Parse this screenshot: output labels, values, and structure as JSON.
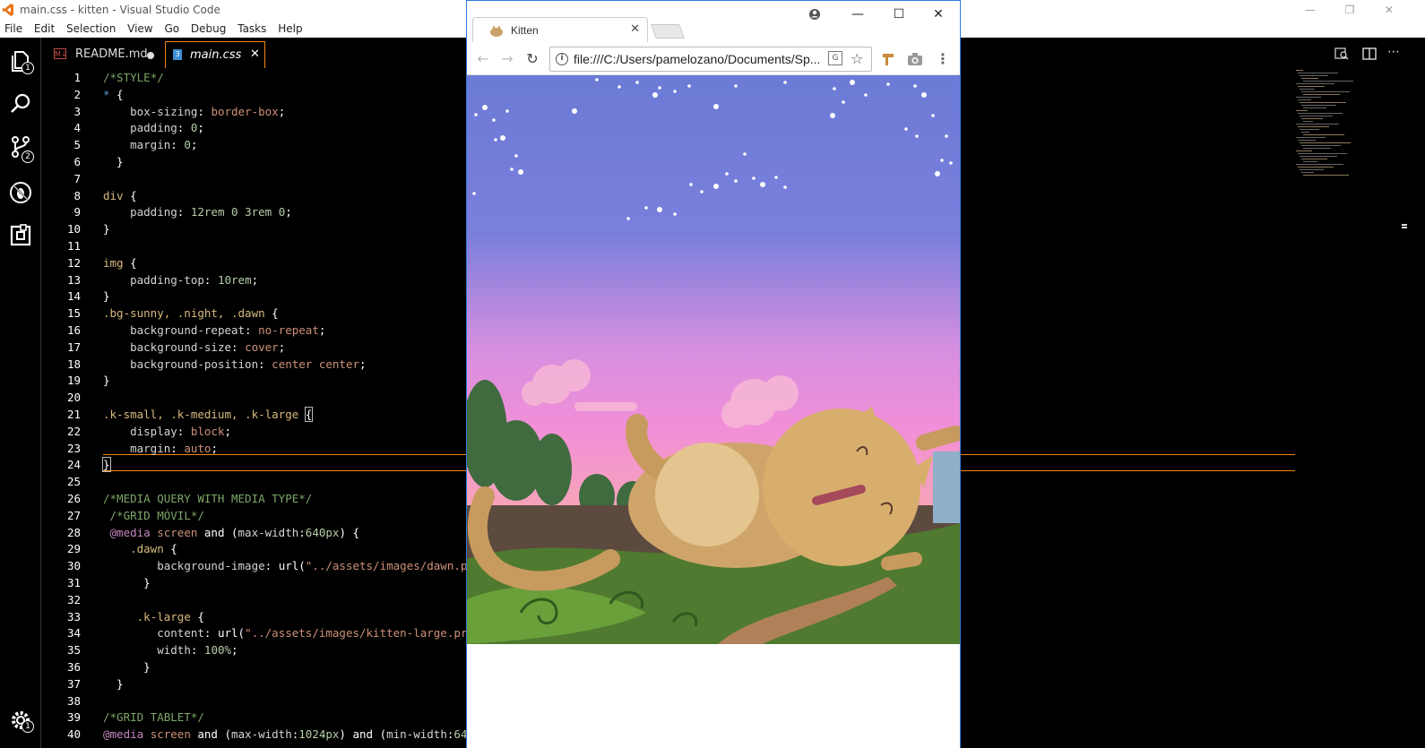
{
  "vscode": {
    "window_title": "main.css - kitten - Visual Studio Code",
    "menu": [
      "File",
      "Edit",
      "Selection",
      "View",
      "Go",
      "Debug",
      "Tasks",
      "Help"
    ],
    "tabs": [
      {
        "label": "README.md",
        "icon": "markdown-icon",
        "modified": true
      },
      {
        "label": "main.css",
        "icon": "css-icon",
        "active": true
      }
    ],
    "badges": {
      "explorer": "1",
      "scm": "2",
      "settings": "1"
    },
    "code": [
      {
        "n": "1",
        "html": "<span class='c-com'>/*STYLE*/</span>"
      },
      {
        "n": "2",
        "html": "<span class='c-kw'>*</span> {"
      },
      {
        "n": "3",
        "html": "    <span class='c-prop'>box-sizing</span>: <span class='c-val'>border-box</span>;"
      },
      {
        "n": "4",
        "html": "    <span class='c-prop'>padding</span>: <span class='c-num'>0</span>;"
      },
      {
        "n": "5",
        "html": "    <span class='c-prop'>margin</span>: <span class='c-num'>0</span>;"
      },
      {
        "n": "6",
        "html": "  }"
      },
      {
        "n": "7",
        "html": ""
      },
      {
        "n": "8",
        "html": "<span class='c-sel'>div</span> {"
      },
      {
        "n": "9",
        "html": "    <span class='c-prop'>padding</span>: <span class='c-num'>12rem</span> <span class='c-num'>0</span> <span class='c-num'>3rem</span> <span class='c-num'>0</span>;"
      },
      {
        "n": "10",
        "html": "}"
      },
      {
        "n": "11",
        "html": ""
      },
      {
        "n": "12",
        "html": "<span class='c-sel'>img</span> {"
      },
      {
        "n": "13",
        "html": "    <span class='c-prop'>padding-top</span>: <span class='c-num'>10rem</span>;"
      },
      {
        "n": "14",
        "html": "}"
      },
      {
        "n": "15",
        "html": "<span class='c-sel'>.bg-sunny, .night, .dawn</span> {"
      },
      {
        "n": "16",
        "html": "    <span class='c-prop'>background-repeat</span>: <span class='c-val'>no-repeat</span>;"
      },
      {
        "n": "17",
        "html": "    <span class='c-prop'>background-size</span>: <span class='c-val'>cover</span>;"
      },
      {
        "n": "18",
        "html": "    <span class='c-prop'>background-position</span>: <span class='c-val'>center center</span>;"
      },
      {
        "n": "19",
        "html": "}"
      },
      {
        "n": "20",
        "html": ""
      },
      {
        "n": "21",
        "html": "<span class='c-sel'>.k-small, .k-medium, .k-large</span> <span style='outline:1px solid #bbb'>{</span>"
      },
      {
        "n": "22",
        "html": "    <span class='c-prop'>display</span>: <span class='c-val'>block</span>;"
      },
      {
        "n": "23",
        "html": "    <span class='c-prop'>margin</span>: <span class='c-val'>auto</span>;"
      },
      {
        "n": "24",
        "html": "<span style='outline:1px solid #bbb'>}</span>"
      },
      {
        "n": "25",
        "html": ""
      },
      {
        "n": "26",
        "html": "<span class='c-com'>/*MEDIA QUERY WITH MEDIA TYPE*/</span>"
      },
      {
        "n": "27",
        "html": " <span class='c-com'>/*GRID MÓVIL*/</span>"
      },
      {
        "n": "28",
        "html": " <span class='c-at'>@media</span> <span class='c-val'>screen</span> and (<span class='c-prop'>max-width</span>:<span class='c-num'>640px</span>) {"
      },
      {
        "n": "29",
        "html": "    <span class='c-sel'>.dawn</span> {"
      },
      {
        "n": "30",
        "html": "        <span class='c-prop'>background-image</span>: url(<span class='c-val'>\"../assets/images/dawn.p</span>"
      },
      {
        "n": "31",
        "html": "      }"
      },
      {
        "n": "32",
        "html": ""
      },
      {
        "n": "33",
        "html": "     <span class='c-sel'>.k-large</span> {"
      },
      {
        "n": "34",
        "html": "        <span class='c-prop'>content</span>: url(<span class='c-val'>\"../assets/images/kitten-large.pr</span>"
      },
      {
        "n": "35",
        "html": "        <span class='c-prop'>width</span>: <span class='c-num'>100%</span>;"
      },
      {
        "n": "36",
        "html": "      }"
      },
      {
        "n": "37",
        "html": "  }"
      },
      {
        "n": "38",
        "html": ""
      },
      {
        "n": "39",
        "html": "<span class='c-com'>/*GRID TABLET*/</span>"
      },
      {
        "n": "40",
        "html": "<span class='c-at'>@media</span> <span class='c-val'>screen</span> and (<span class='c-prop'>max-width</span>:<span class='c-num'>1024px</span>) and (<span class='c-prop'>min-width</span>:<span class='c-num'>64</span>"
      }
    ]
  },
  "chrome": {
    "tab_title": "Kitten",
    "url": "file:///C:/Users/pamelozano/Documents/Sp..."
  },
  "colors": {
    "accent": "#f38518",
    "chrome_border": "#2b79d8",
    "sky_top": "#6b7bd6",
    "sky_pink": "#f28fd8"
  }
}
